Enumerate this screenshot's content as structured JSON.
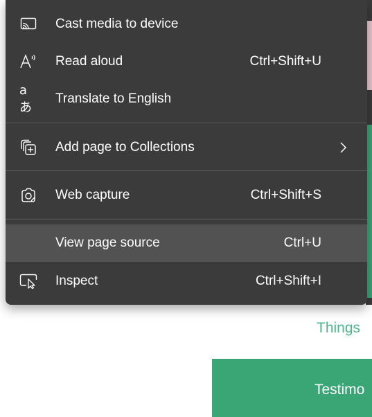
{
  "menu": {
    "items": [
      {
        "icon": "cast-icon",
        "label": "Cast media to device",
        "shortcut": ""
      },
      {
        "icon": "read-aloud-icon",
        "label": "Read aloud",
        "shortcut": "Ctrl+Shift+U"
      },
      {
        "icon": "translate-icon",
        "icon_text": "aあ",
        "label": "Translate to English",
        "shortcut": ""
      },
      {
        "icon": "collections-add-icon",
        "label": "Add page to Collections",
        "shortcut": "",
        "has_submenu": true
      },
      {
        "icon": "web-capture-icon",
        "label": "Web capture",
        "shortcut": "Ctrl+Shift+S"
      },
      {
        "icon": "",
        "label": "View page source",
        "shortcut": "Ctrl+U",
        "highlighted": true
      },
      {
        "icon": "inspect-icon",
        "label": "Inspect",
        "shortcut": "Ctrl+Shift+I"
      }
    ]
  },
  "background": {
    "link_text": "Things",
    "button_text": "Testimo"
  },
  "colors": {
    "menu_bg": "#3b3b3b",
    "highlight_bg": "#525252",
    "accent_green": "#3aa676",
    "link_green": "#4fb58d"
  }
}
